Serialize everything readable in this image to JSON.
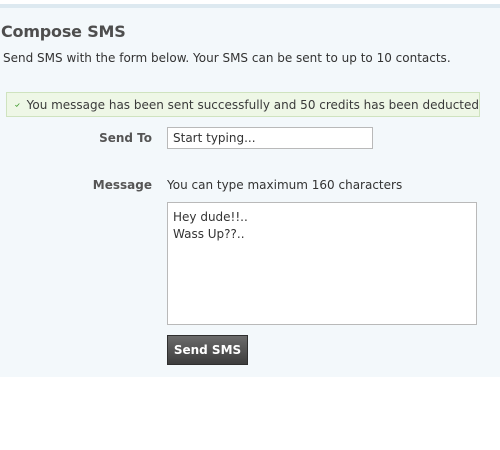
{
  "page": {
    "title": "Compose SMS",
    "subtitle": "Send SMS with the form below. Your SMS can be sent to up to 10 contacts."
  },
  "notice": {
    "icon": "check-icon",
    "message": "You message has been sent successfully and 50 credits has been deducted",
    "colors": {
      "background": "#eef7e6",
      "border": "#cfe3bf",
      "icon": "#3f9a2c"
    }
  },
  "form": {
    "send_to": {
      "label": "Send To",
      "placeholder": "Start typing..."
    },
    "message": {
      "label": "Message",
      "hint": "You can type maximum 160 characters",
      "value": "Hey dude!!..\nWass Up??.."
    },
    "submit_label": "Send SMS"
  }
}
